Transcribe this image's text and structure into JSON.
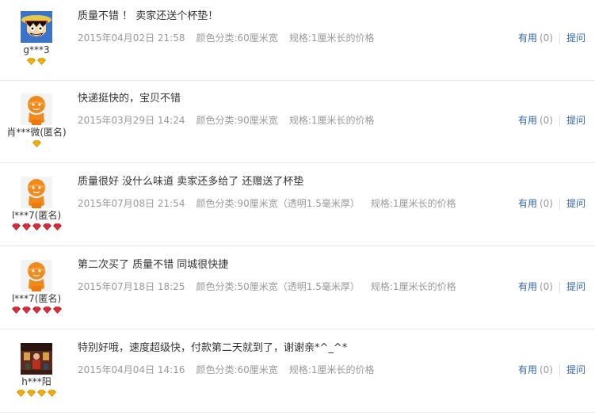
{
  "reviews": [
    {
      "user": "g***3",
      "avatar": "luffy",
      "badge_count": 2,
      "badge_type": "gold",
      "text": "质量不错 ！ 卖家还送个杯垫！",
      "date": "2015年04月02日 21:58",
      "color": "颜色分类:60厘米宽",
      "spec": "规格:1厘米长的价格",
      "useful": "有用",
      "count": "(0)",
      "ask": "提问"
    },
    {
      "user": "肖***微(匿名)",
      "avatar": "mascot",
      "badge_count": 1,
      "badge_type": "gold",
      "text": "快递挺快的，宝贝不错",
      "date": "2015年03月29日 14:24",
      "color": "颜色分类:90厘米宽",
      "spec": "规格:1厘米长的价格",
      "useful": "有用",
      "count": "(0)",
      "ask": "提问"
    },
    {
      "user": "l***7(匿名)",
      "avatar": "mascot",
      "badge_count": 5,
      "badge_type": "red",
      "text": "质量很好 没什么味道 卖家还多给了 还赠送了杯垫",
      "date": "2015年07月08日 21:54",
      "color": "颜色分类:90厘米宽（透明1.5毫米厚）",
      "spec": "规格:1厘米长的价格",
      "useful": "有用",
      "count": "(0)",
      "ask": "提问"
    },
    {
      "user": "l***7(匿名)",
      "avatar": "mascot",
      "badge_count": 5,
      "badge_type": "red",
      "text": "第二次买了 质量不错 同城很快捷",
      "date": "2015年07月18日 18:25",
      "color": "颜色分类:50厘米宽（透明1.5毫米厚）",
      "spec": "规格:1厘米长的价格",
      "useful": "有用",
      "count": "(0)",
      "ask": "提问"
    },
    {
      "user": "h***阳",
      "avatar": "photo",
      "badge_count": 4,
      "badge_type": "gold",
      "text": "特别好哦，速度超级快，付款第二天就到了，谢谢亲*^_^*",
      "date": "2015年04月04日 14:16",
      "color": "颜色分类:60厘米宽",
      "spec": "规格:1厘米长的价格",
      "useful": "有用",
      "count": "(0)",
      "ask": "提问"
    }
  ],
  "colors": {
    "link": "#3366aa",
    "meta": "#999999",
    "gold_badge": "#f5b400",
    "red_badge": "#e0303c"
  }
}
